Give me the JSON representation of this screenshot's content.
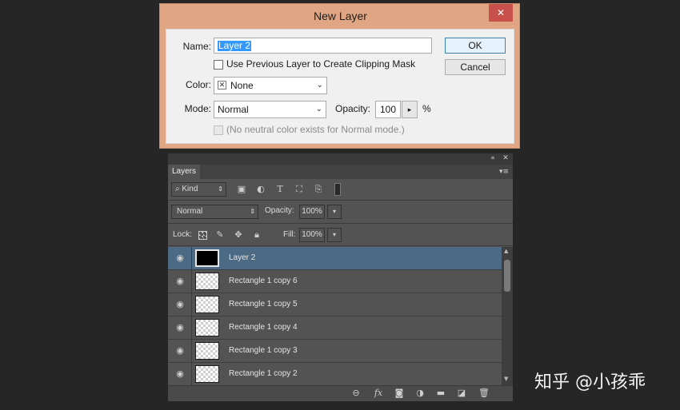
{
  "dialog": {
    "title": "New Layer",
    "close_glyph": "✕",
    "name_label": "Name:",
    "name_value": "Layer 2",
    "clipping_label": "Use Previous Layer to Create Clipping Mask",
    "color_label": "Color:",
    "color_value": "None",
    "mode_label": "Mode:",
    "mode_value": "Normal",
    "opacity_label": "Opacity:",
    "opacity_value": "100",
    "opacity_unit": "%",
    "neutral_label": "(No neutral color exists for Normal mode.)",
    "ok_label": "OK",
    "cancel_label": "Cancel",
    "title_bar_color": "#e0a683",
    "close_color": "#c7504a"
  },
  "panel": {
    "tab_label": "Layers",
    "filter_label": "Kind",
    "blend_mode": "Normal",
    "opacity_label": "Opacity:",
    "opacity_value": "100%",
    "lock_label": "Lock:",
    "fill_label": "Fill:",
    "fill_value": "100%",
    "layers": [
      {
        "name": "Layer 2",
        "selected": true,
        "thumb": "black"
      },
      {
        "name": "Rectangle 1 copy 6",
        "selected": false,
        "thumb": "transparent"
      },
      {
        "name": "Rectangle 1 copy 5",
        "selected": false,
        "thumb": "transparent"
      },
      {
        "name": "Rectangle 1 copy 4",
        "selected": false,
        "thumb": "transparent"
      },
      {
        "name": "Rectangle 1 copy 3",
        "selected": false,
        "thumb": "transparent"
      },
      {
        "name": "Rectangle 1 copy 2",
        "selected": false,
        "thumb": "transparent"
      }
    ],
    "selected_color": "#4d6a84",
    "footer_icons": [
      "link-icon",
      "fx-icon",
      "mask-icon",
      "adjustment-icon",
      "folder-icon",
      "new-layer-icon",
      "trash-icon"
    ],
    "fx_label": "fx"
  },
  "watermark": "知乎 @小孩乖"
}
